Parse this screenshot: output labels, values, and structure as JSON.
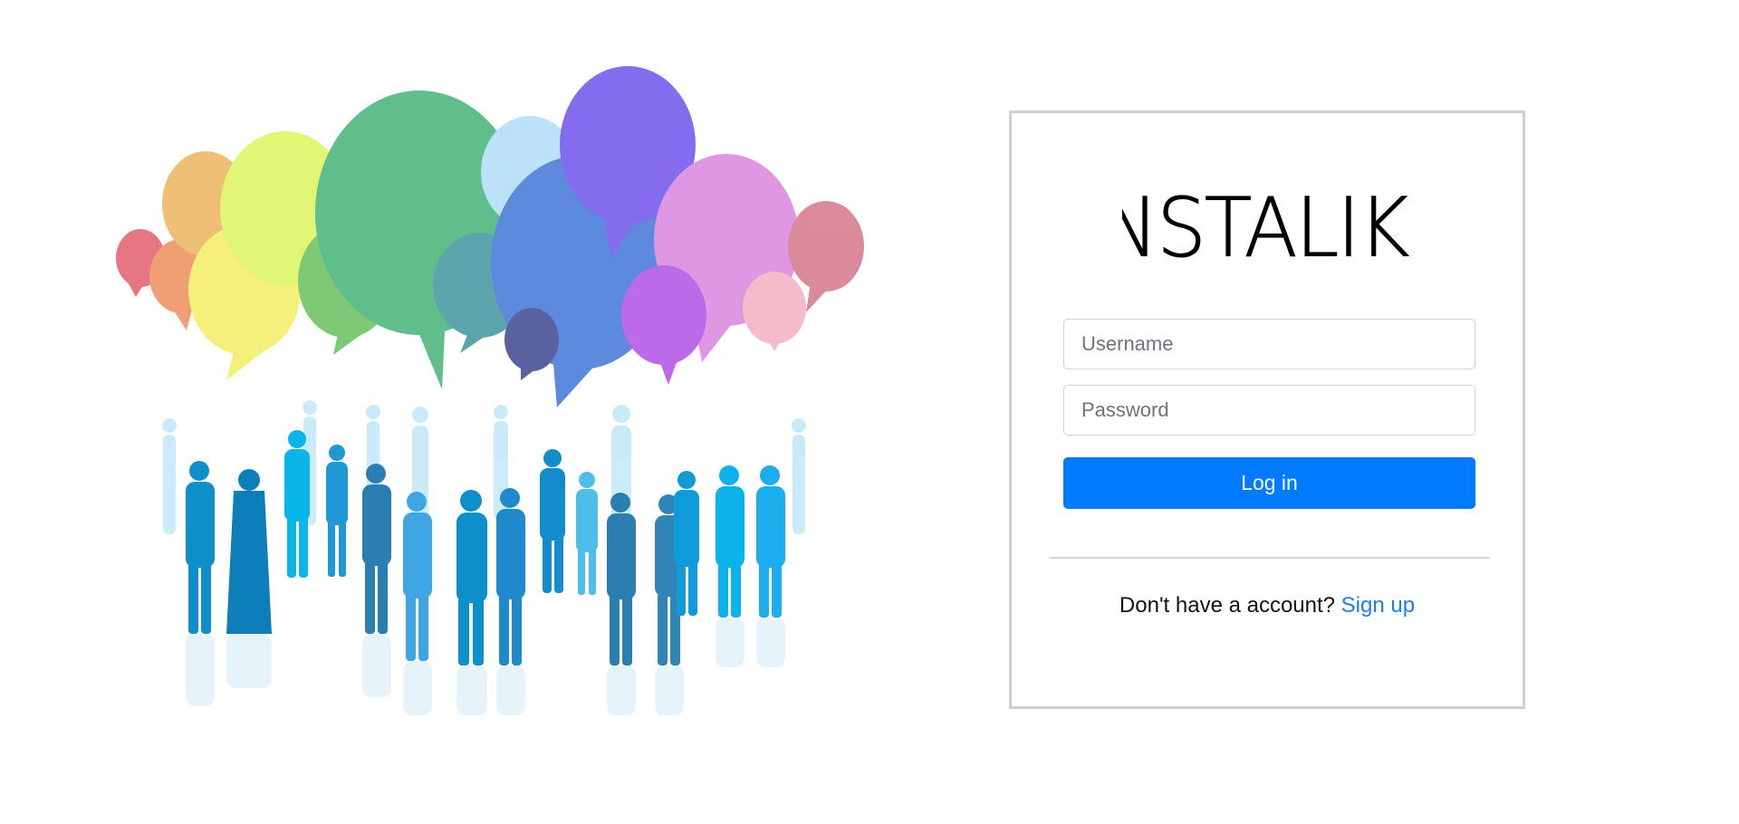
{
  "hero": {
    "illustration": "people-with-speech-bubbles"
  },
  "login": {
    "logo_text": "INSTALIKE",
    "username_placeholder": "Username",
    "password_placeholder": "Password",
    "login_button": "Log in",
    "signup_prompt": "Don't have a account?",
    "signup_link": "Sign up"
  },
  "colors": {
    "primary": "#007bff",
    "link": "#1a7ef0",
    "card_border": "#d0d0d0"
  }
}
